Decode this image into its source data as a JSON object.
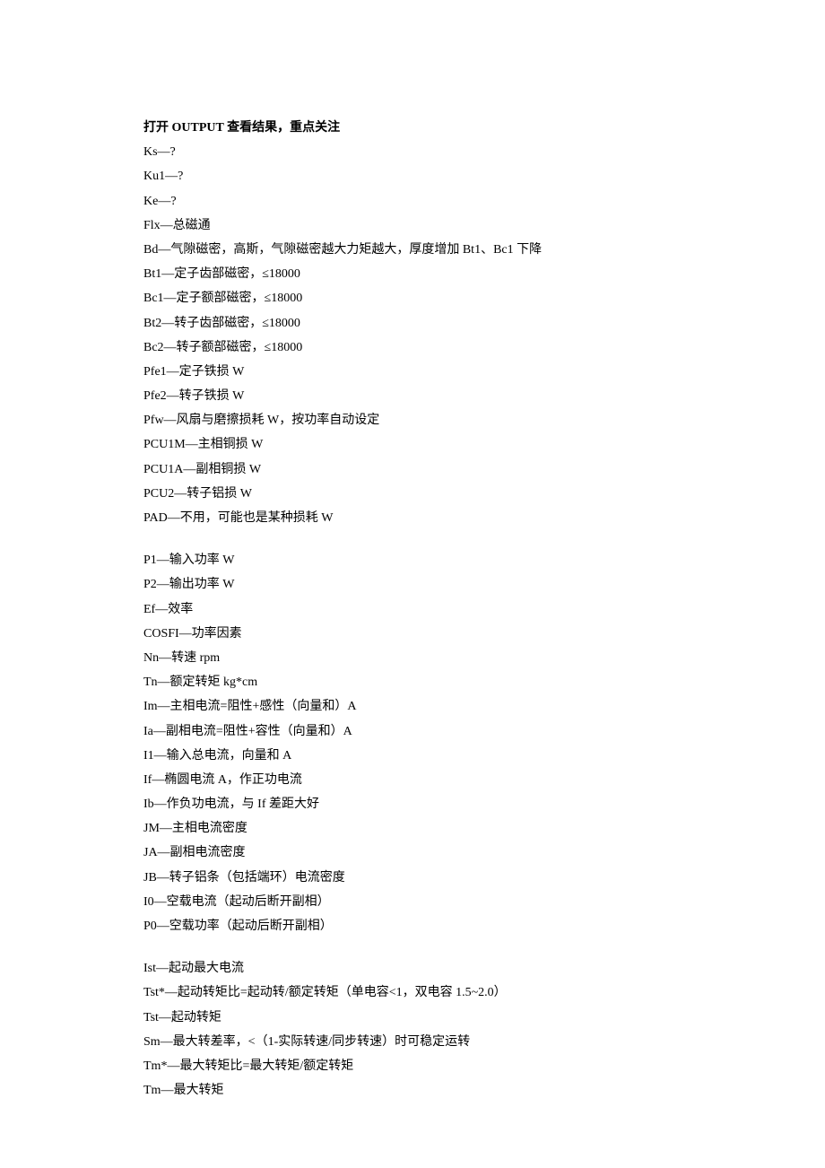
{
  "heading": "打开 OUTPUT 查看结果，重点关注",
  "section1": [
    "Ks—?",
    "Ku1—?",
    "Ke—?",
    "Flx—总磁通",
    "Bd—气隙磁密，高斯，气隙磁密越大力矩越大，厚度增加 Bt1、Bc1 下降",
    "Bt1—定子齿部磁密，≤18000",
    "Bc1—定子额部磁密，≤18000",
    "Bt2—转子齿部磁密，≤18000",
    "Bc2—转子额部磁密，≤18000",
    "Pfe1—定子铁损 W",
    "Pfe2—转子铁损 W",
    "Pfw—风扇与磨擦损耗 W，按功率自动设定",
    "PCU1M—主相铜损 W",
    "PCU1A—副相铜损 W",
    "PCU2—转子铝损 W",
    "PAD—不用，可能也是某种损耗 W"
  ],
  "section2": [
    "P1—输入功率 W",
    "P2—输出功率 W",
    "Ef—效率",
    "COSFI—功率因素",
    "Nn—转速 rpm",
    "Tn—额定转矩 kg*cm",
    "Im—主相电流=阻性+感性（向量和）A",
    "Ia—副相电流=阻性+容性（向量和）A",
    "I1—输入总电流，向量和 A",
    "If—椭圆电流 A，作正功电流",
    "Ib—作负功电流，与 If 差距大好",
    "JM—主相电流密度",
    "JA—副相电流密度",
    "JB—转子铝条（包括端环）电流密度",
    "I0—空载电流（起动后断开副相）",
    "P0—空载功率（起动后断开副相）"
  ],
  "section3": [
    "Ist—起动最大电流",
    "Tst*—起动转矩比=起动转/额定转矩（单电容<1，双电容 1.5~2.0）",
    "Tst—起动转矩",
    "Sm—最大转差率，<（1-实际转速/同步转速）时可稳定运转",
    "Tm*—最大转矩比=最大转矩/额定转矩",
    "Tm—最大转矩"
  ]
}
